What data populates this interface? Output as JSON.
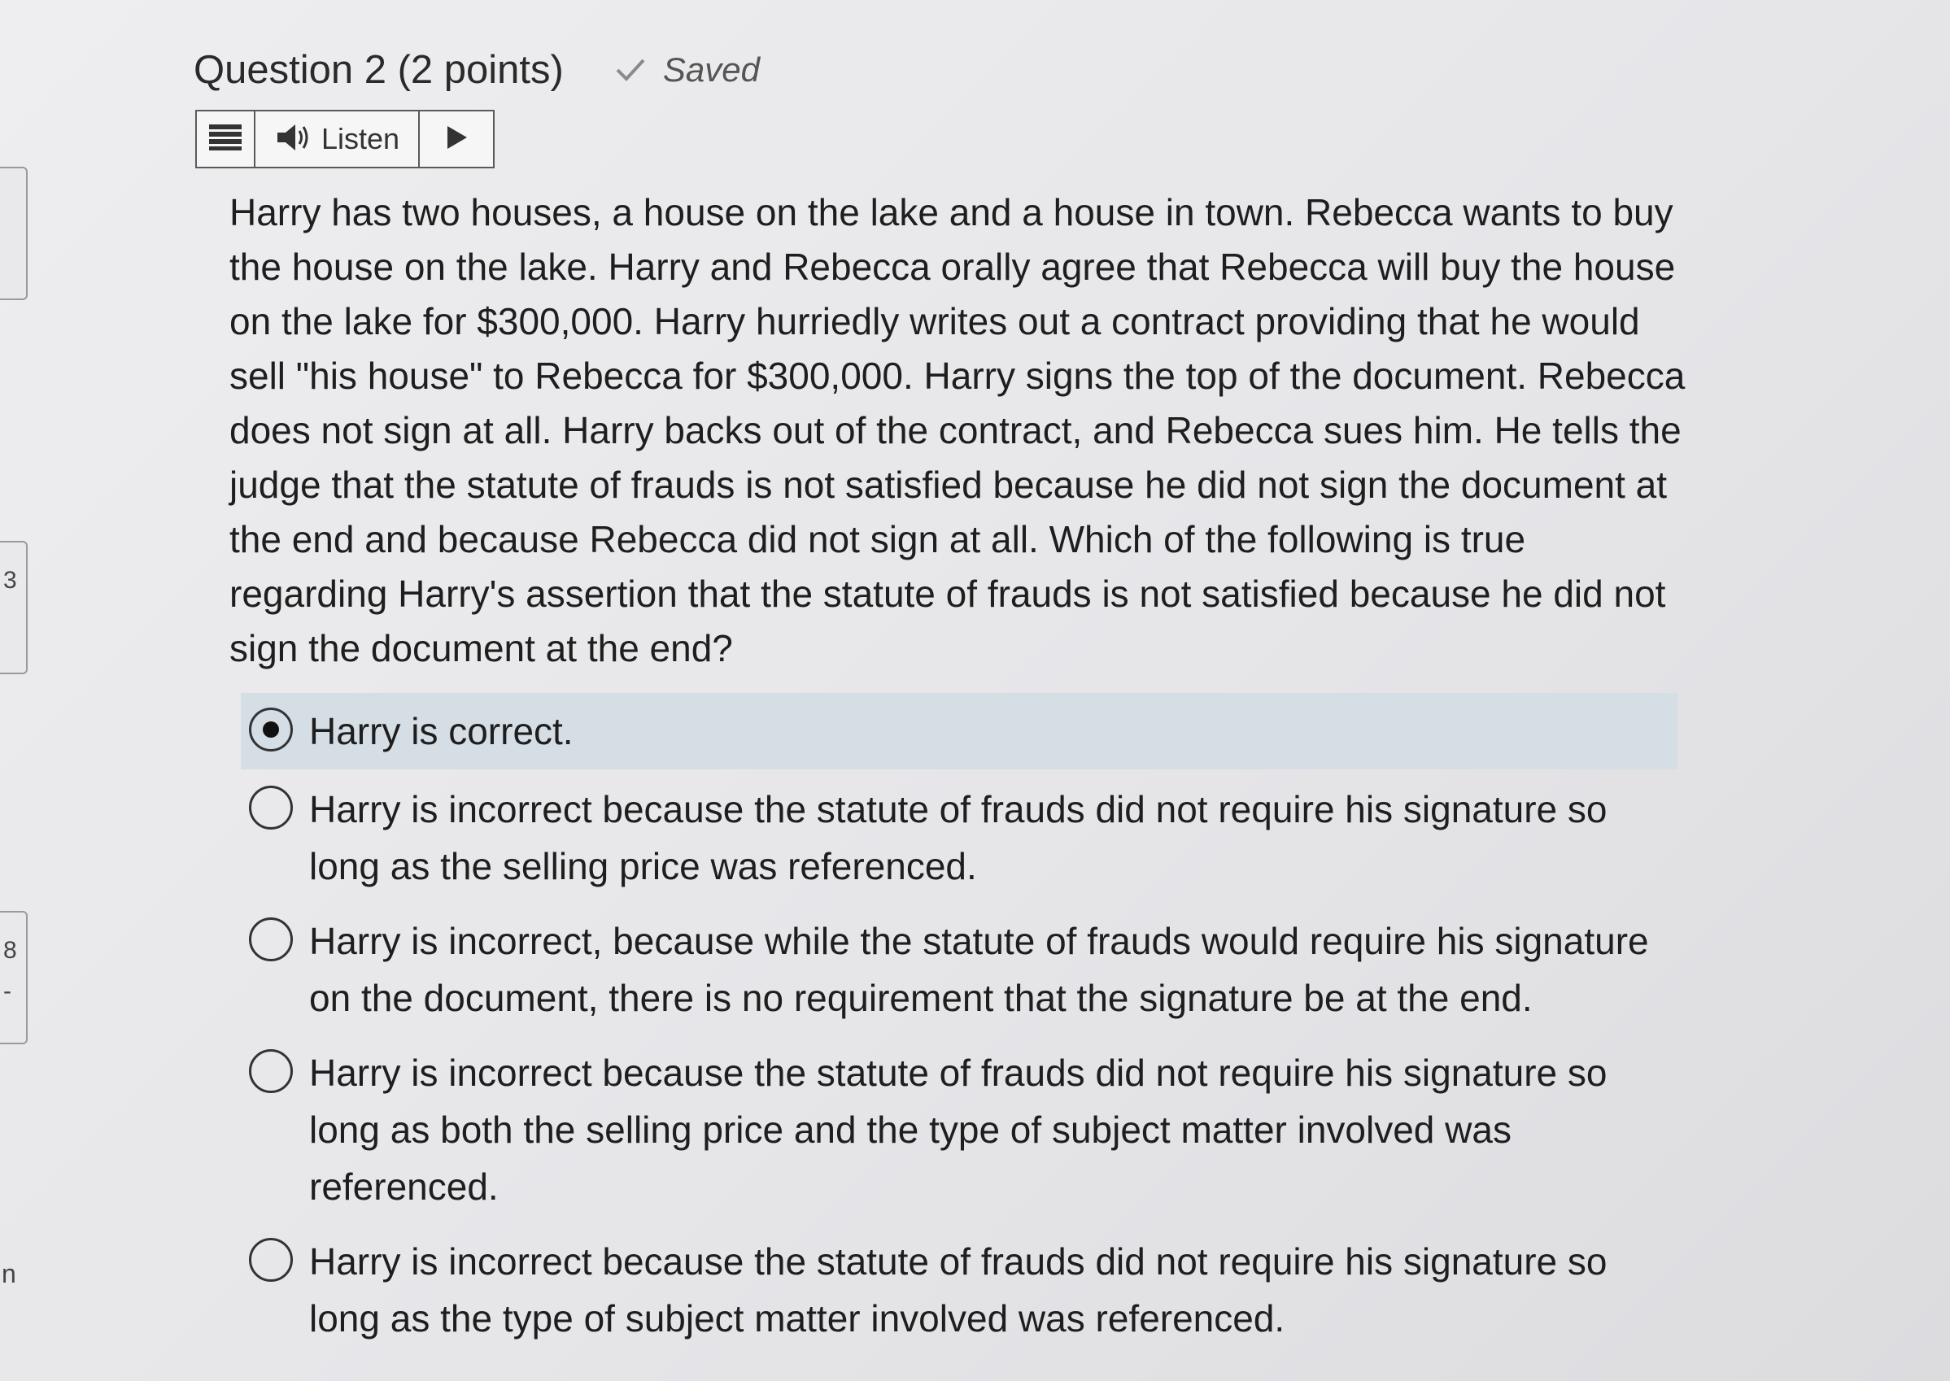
{
  "question": {
    "title": "Question 2 (2 points)",
    "saved_label": "Saved",
    "text": "Harry has two houses, a house on the lake and a house in town. Rebecca wants to buy the house on the lake. Harry and Rebecca orally agree that Rebecca will buy the house on the lake for $300,000. Harry hurriedly writes out a contract providing that he would sell \"his house\" to Rebecca for $300,000. Harry signs the top of the document. Rebecca does not sign at all. Harry backs out of the contract, and Rebecca sues him. He tells the judge that the statute of frauds is not satisfied because he did not sign the document at the end and because Rebecca did not sign at all. Which of the following is true regarding Harry's assertion that the statute of frauds is not satisfied because he did not sign the document at the end?"
  },
  "toolbar": {
    "menu_icon": "hamburger-menu-icon",
    "listen_icon": "speaker-icon",
    "listen_label": "Listen",
    "play_icon": "play-icon"
  },
  "answers": [
    {
      "label": "Harry is correct.",
      "selected": true
    },
    {
      "label": "Harry is incorrect because the statute of frauds did not require his signature so long as the selling price was referenced.",
      "selected": false
    },
    {
      "label": "Harry is incorrect, because while the statute of frauds would require his signature on the document, there is no requirement that the signature be at the end.",
      "selected": false
    },
    {
      "label": "Harry is incorrect because the statute of frauds did not require his signature so long as both the selling price and the type of subject matter involved was referenced.",
      "selected": false
    },
    {
      "label": "Harry is incorrect because the statute of frauds did not require his signature so long as the type of subject matter involved was referenced.",
      "selected": false
    }
  ],
  "left_edge": {
    "marks": [
      "3",
      "8",
      "-",
      "n"
    ]
  },
  "colors": {
    "selected_row": "#d5dde5",
    "background": "#e8e8ea",
    "text": "#1e1e1e"
  }
}
